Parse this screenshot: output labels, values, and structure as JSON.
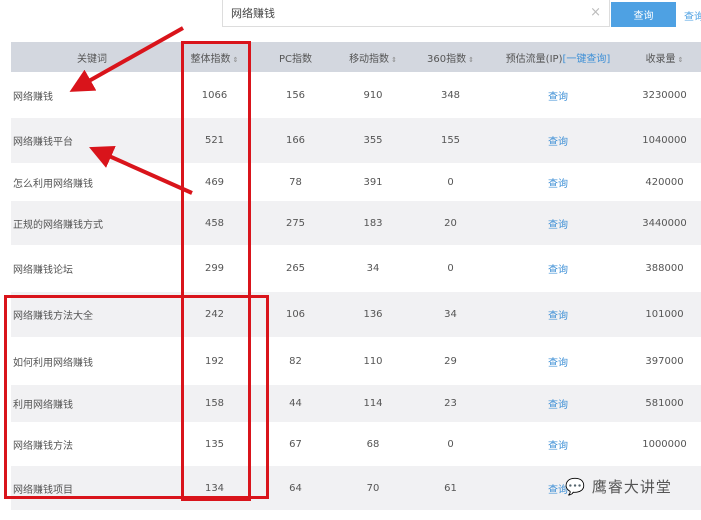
{
  "search": {
    "value": "网络赚钱",
    "clear_icon": "×",
    "button": "查询",
    "extra_link": "查询"
  },
  "headers": {
    "keyword": "关键词",
    "total": "整体指数",
    "pc": "PC指数",
    "mobile": "移动指数",
    "i360": "360指数",
    "traffic": "预估流量(IP)",
    "traffic_link": "[一键查询]",
    "indexed": "收录量",
    "sort_icon": "⇕"
  },
  "rows": [
    {
      "keyword": "网络赚钱",
      "total": "1066",
      "pc": "156",
      "mobile": "910",
      "i360": "348",
      "traffic": "查询",
      "indexed": "3230000"
    },
    {
      "keyword": "网络赚钱平台",
      "total": "521",
      "pc": "166",
      "mobile": "355",
      "i360": "155",
      "traffic": "查询",
      "indexed": "1040000"
    },
    {
      "keyword": "怎么利用网络赚钱",
      "total": "469",
      "pc": "78",
      "mobile": "391",
      "i360": "0",
      "traffic": "查询",
      "indexed": "420000"
    },
    {
      "keyword": "正规的网络赚钱方式",
      "total": "458",
      "pc": "275",
      "mobile": "183",
      "i360": "20",
      "traffic": "查询",
      "indexed": "3440000"
    },
    {
      "keyword": "网络赚钱论坛",
      "total": "299",
      "pc": "265",
      "mobile": "34",
      "i360": "0",
      "traffic": "查询",
      "indexed": "388000"
    },
    {
      "keyword": "网络赚钱方法大全",
      "total": "242",
      "pc": "106",
      "mobile": "136",
      "i360": "34",
      "traffic": "查询",
      "indexed": "101000"
    },
    {
      "keyword": "如何利用网络赚钱",
      "total": "192",
      "pc": "82",
      "mobile": "110",
      "i360": "29",
      "traffic": "查询",
      "indexed": "397000"
    },
    {
      "keyword": "利用网络赚钱",
      "total": "158",
      "pc": "44",
      "mobile": "114",
      "i360": "23",
      "traffic": "查询",
      "indexed": "581000"
    },
    {
      "keyword": "网络赚钱方法",
      "total": "135",
      "pc": "67",
      "mobile": "68",
      "i360": "0",
      "traffic": "查询",
      "indexed": "1000000"
    },
    {
      "keyword": "网络赚钱项目",
      "total": "134",
      "pc": "64",
      "mobile": "70",
      "i360": "61",
      "traffic": "查询",
      "indexed": ""
    }
  ],
  "watermark": {
    "text": "鹰睿大讲堂",
    "icon": "wechat-icon"
  },
  "colors": {
    "accent": "#4ea1e3",
    "annotation": "#d9141b",
    "header_bg": "#d3d7df"
  }
}
